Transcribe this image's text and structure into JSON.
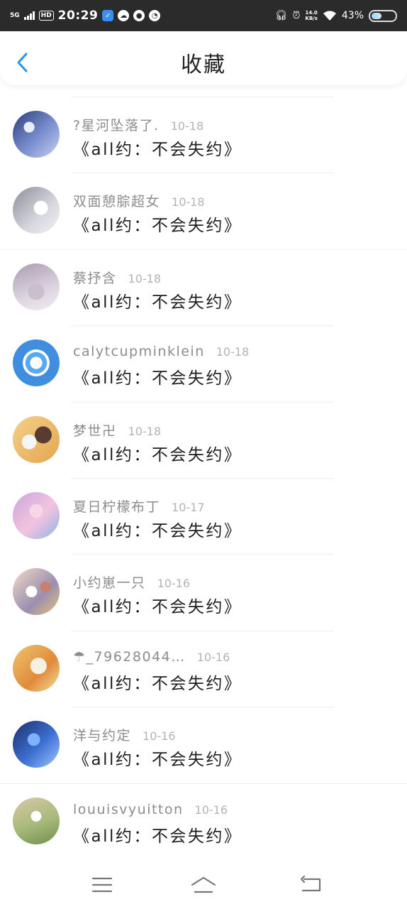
{
  "status_bar": {
    "network": "5G",
    "hd": "HD",
    "time": "20:29",
    "speed_value": "14.0",
    "speed_unit": "KB/s",
    "battery": "43%",
    "battery_level": 0.43
  },
  "header": {
    "title": "收藏",
    "back_icon": "chevron-left-icon",
    "accent_color": "#2196F3"
  },
  "items": [
    {
      "username": "?星河坠落了.",
      "date": "10-18",
      "message": "《all约：不会失约》",
      "avatar": "anime-couple-avatar"
    },
    {
      "username": "双面憩腙超女",
      "date": "10-18",
      "message": "《all约：不会失约》",
      "avatar": "white-bird-avatar"
    },
    {
      "username": "蔡抒含",
      "date": "10-18",
      "message": "《all约：不会失约》",
      "avatar": "mirror-selfie-avatar"
    },
    {
      "username": "calytcupminklein",
      "date": "10-18",
      "message": "《all约：不会失约》",
      "avatar": "snowflake-avatar"
    },
    {
      "username": "梦世卍",
      "date": "10-18",
      "message": "《all约：不会失约》",
      "avatar": "skeleton-character-avatar"
    },
    {
      "username": "夏日柠檬布丁",
      "date": "10-17",
      "message": "《all约：不会失约》",
      "avatar": "pink-anime-girl-avatar"
    },
    {
      "username": "小约崽一只",
      "date": "10-16",
      "message": "《all约：不会失约》",
      "avatar": "anime-group-avatar"
    },
    {
      "username": "☂_79628044…",
      "date": "10-16",
      "message": "《all约：不会失约》",
      "avatar": "hamster-avatar"
    },
    {
      "username": "洋与约定",
      "date": "10-16",
      "message": "《all约：不会失约》",
      "avatar": "blue-hair-character-avatar"
    },
    {
      "username": "louuisvyuitton",
      "date": "10-16",
      "message": "《all约：不会失约》",
      "avatar": "dandelion-avatar"
    }
  ],
  "nav_bar": {
    "menu_icon": "menu-icon",
    "home_icon": "home-icon",
    "back_icon": "back-arrow-icon"
  }
}
